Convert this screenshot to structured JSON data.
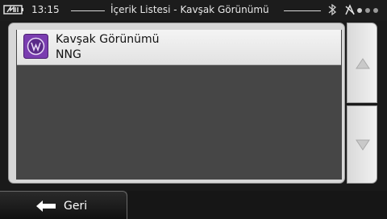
{
  "status_bar": {
    "time": "13:15",
    "title": "İçerik Listesi - Kavşak Görünümü",
    "icons": [
      "battery-icon",
      "bluetooth-icon",
      "gps-icon",
      "signal-dots-icon"
    ]
  },
  "list": {
    "items": [
      {
        "title": "Kavşak Görünümü",
        "subtitle": "NNG",
        "icon": "junction-view-icon",
        "selected": true
      }
    ]
  },
  "scroll": {
    "up_icon": "triangle-up-icon",
    "down_icon": "triangle-down-icon"
  },
  "footer": {
    "back_label": "Geri",
    "back_icon": "arrow-left-icon"
  },
  "colors": {
    "list_background": "#464646",
    "item_background": "#ececec",
    "icon_purple": "#7a3db0",
    "frame": "#d7d7d7"
  }
}
